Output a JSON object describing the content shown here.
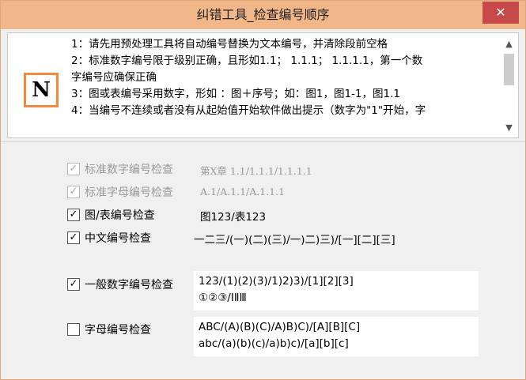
{
  "window": {
    "title": "纠错工具_检查编号顺序",
    "close_glyph": "✕"
  },
  "header": {
    "logo_letter": "N",
    "description_lines": [
      "1：请先用预处理工具将自动编号替换为文本编号，并清除段前空格",
      "2：标准数字编号限于级别正确，且形如1.1；   1.1.1；   1.1.1.1，第一个数",
      "字编号应确保正确",
      "3：图或表编号采用数字，形如  ：图＋序号；如：图1，图1-1，图1.1",
      "4：当编号不连续或者没有从起始值开始软件做出提示（数字为\"1\"开始，字"
    ],
    "scroll_up_glyph": "▲",
    "scroll_down_glyph": "▼"
  },
  "options": [
    {
      "label": "标准数字编号检查",
      "checked": true,
      "disabled": true,
      "sample": "第X章 1.1/1.1.1/1.1.1.1"
    },
    {
      "label": "标准字母编号检查",
      "checked": true,
      "disabled": true,
      "sample": "A.1/A.1.1/A.1.1.1"
    },
    {
      "label": "图/表编号检查",
      "checked": true,
      "disabled": false,
      "sample": "图123/表123"
    },
    {
      "label": "中文编号检查",
      "checked": true,
      "disabled": false,
      "sample": "一二三/(一)(二)(三)/一)二)三)/[一][二][三]"
    },
    {
      "label": "一般数字编号检查",
      "checked": true,
      "disabled": false,
      "sample_lines": [
        "123/(1)(2)(3)/1)2)3)/[1][2][3]",
        "①②③/ⅠⅡⅢ"
      ]
    },
    {
      "label": "字母编号检查",
      "checked": false,
      "disabled": false,
      "sample_lines": [
        "ABC/(A)(B)(C)/A)B)C)/[A][B][C]",
        "abc/(a)(b)(c)/a)b)c)/[a][b][c]"
      ]
    }
  ],
  "check_glyph": "✓",
  "colors": {
    "titlebar": "#f2b789",
    "close": "#c74949",
    "logo_border": "#f08a3c",
    "disabled_text": "#9a9a9a"
  }
}
